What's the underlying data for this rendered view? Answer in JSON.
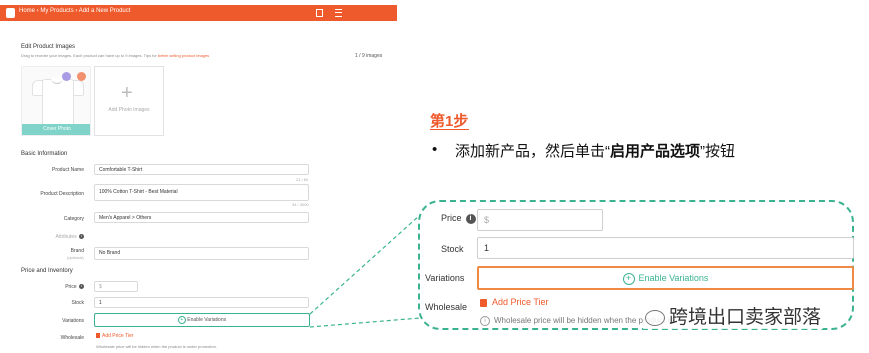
{
  "header": {
    "breadcrumb_home": "Home",
    "breadcrumb_products": "My Products",
    "breadcrumb_current": "Add a New Product",
    "sep": " › "
  },
  "images": {
    "section_title": "Edit Product Images",
    "hint": "Drag to reorder your images. Each product can have up to 9 images. Tips for",
    "hint_link": "better selling product images",
    "count": "1 / 9 images",
    "cover_label": "Cover Photo",
    "add_label": "Add Photo Images"
  },
  "basic": {
    "section_title": "Basic Information",
    "name_label": "Product Name",
    "name_value": "Comfortable T-Shirt",
    "name_count": "21 / 60",
    "desc_label": "Product Description",
    "desc_value": "100% Cotton T-Shirt - Best Material",
    "desc_count": "34 / 3000",
    "category_label": "Category",
    "category_value": "Men's Apparel  >  Others",
    "attributes_label": "Attributes",
    "brand_label": "Brand",
    "brand_sub": "(optional)",
    "brand_value": "No Brand"
  },
  "pricing": {
    "section_title": "Price and Inventory",
    "price_label": "Price",
    "price_placeholder": "$",
    "stock_label": "Stock",
    "stock_value": "1",
    "variations_label": "Variations",
    "enable_variations": "Enable Variations",
    "wholesale_label": "Wholesale",
    "add_price_tier": "Add Price Tier",
    "wholesale_note_small": "Wholesale price will be hidden when the product is under promotion.",
    "wholesale_note_zoom": "Wholesale price will be hidden when the product is"
  },
  "annotation": {
    "step": "第1步",
    "bullet": "•",
    "desc_pre": "添加新产品，然后单击“",
    "desc_bold": "启用产品选项",
    "desc_post": "”按钮"
  },
  "watermark": "跨境出口卖家部落",
  "colors": {
    "brand": "#ee5a2c",
    "accent": "#3bb391",
    "highlight": "#ee8a44"
  },
  "icons": [
    "shop-logo-icon",
    "info-icon",
    "plus-circle-icon",
    "price-tier-icon",
    "wechat-icon"
  ]
}
